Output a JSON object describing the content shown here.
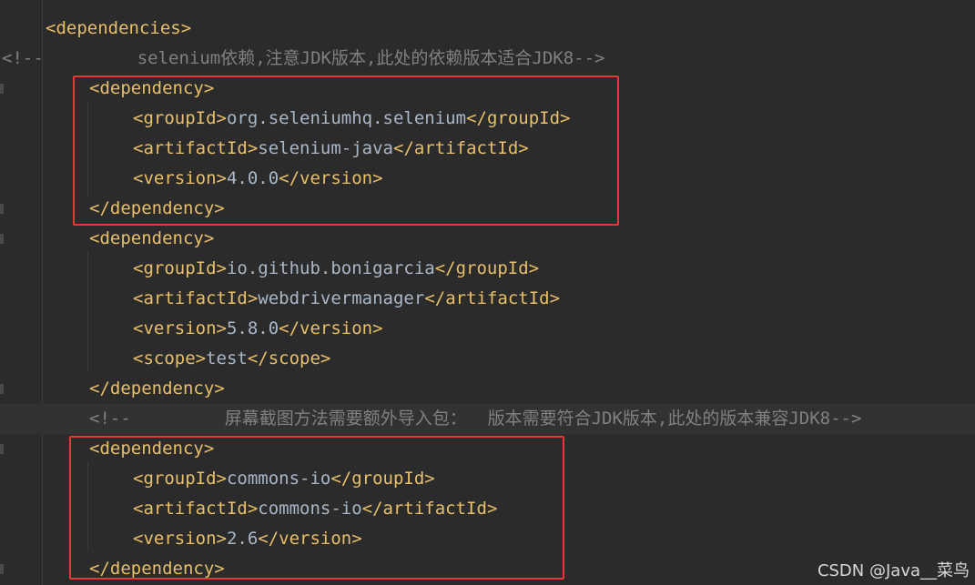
{
  "editor": {
    "colors": {
      "background": "#2b2b2b",
      "tag": "#e8bf6a",
      "text": "#a9b7c6",
      "comment": "#808080",
      "highlight_box": "#e53935"
    },
    "lines": [
      {
        "open": "<dependencies>",
        "text": "",
        "close": ""
      },
      {
        "comment": "<!--         selenium依赖,注意JDK版本,此处的依赖版本适合JDK8-->"
      },
      {
        "open": "<dependency>",
        "text": "",
        "close": ""
      },
      {
        "open": "<groupId>",
        "text": "org.seleniumhq.selenium",
        "close": "</groupId>"
      },
      {
        "open": "<artifactId>",
        "text": "selenium-java",
        "close": "</artifactId>"
      },
      {
        "open": "<version>",
        "text": "4.0.0",
        "close": "</version>"
      },
      {
        "open": "</dependency>",
        "text": "",
        "close": ""
      },
      {
        "open": "<dependency>",
        "text": "",
        "close": ""
      },
      {
        "open": "<groupId>",
        "text": "io.github.bonigarcia",
        "close": "</groupId>"
      },
      {
        "open": "<artifactId>",
        "text": "webdrivermanager",
        "close": "</artifactId>"
      },
      {
        "open": "<version>",
        "text": "5.8.0",
        "close": "</version>"
      },
      {
        "open": "<scope>",
        "text": "test",
        "close": "</scope>"
      },
      {
        "open": "</dependency>",
        "text": "",
        "close": ""
      },
      {
        "comment": "<!--         屏幕截图方法需要额外导入包：  版本需要符合JDK版本,此处的版本兼容JDK8-->"
      },
      {
        "open": "<dependency>",
        "text": "",
        "close": ""
      },
      {
        "open": "<groupId>",
        "text": "commons-io",
        "close": "</groupId>"
      },
      {
        "open": "<artifactId>",
        "text": "commons-io",
        "close": "</artifactId>"
      },
      {
        "open": "<version>",
        "text": "2.6",
        "close": "</version>"
      },
      {
        "open": "</dependency>",
        "text": "",
        "close": ""
      }
    ]
  },
  "watermark": "CSDN @Java__菜鸟"
}
